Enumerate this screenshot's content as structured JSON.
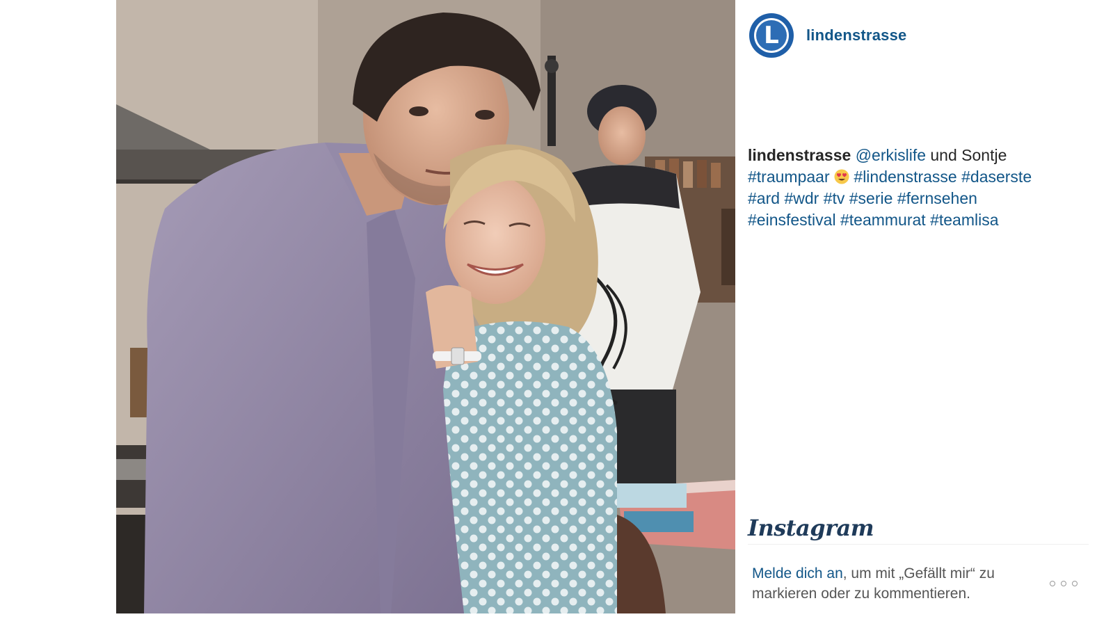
{
  "profile": {
    "username": "lindenstrasse",
    "avatar_letter": "L"
  },
  "caption": {
    "author": "lindenstrasse",
    "mention": "@erkislife",
    "text_plain": "und Sontje",
    "tags_line1_a": "#traumpaar",
    "emoji": "heart-eyes-emoji",
    "tags_line1_b": "#lindenstrasse",
    "tags_line1_c": "#daserste",
    "tags_line2": [
      "#ard",
      "#wdr",
      "#tv",
      "#serie",
      "#fernsehen"
    ],
    "tags_line3": [
      "#einsfestival",
      "#teammurat",
      "#teamlisa"
    ]
  },
  "footer": {
    "brand": "Instagram",
    "login_link": "Melde dich an",
    "login_rest": ", um mit „Gefällt mir“ zu markieren oder zu kommentieren."
  },
  "colors": {
    "link": "#125688",
    "text": "#262626",
    "avatar": "#1f5fa8"
  }
}
